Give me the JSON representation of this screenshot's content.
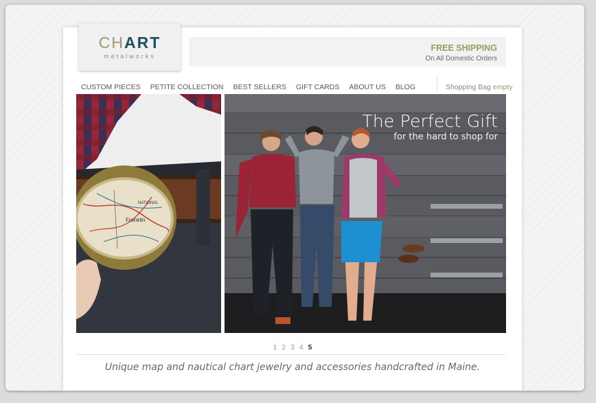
{
  "logo": {
    "part1": "CH",
    "part2": "ART",
    "sub": "metalworks"
  },
  "shipping": {
    "title": "FREE SHIPPING",
    "sub": "On All Domestic Orders"
  },
  "nav": {
    "items": [
      "CUSTOM PIECES",
      "PETITE COLLECTION",
      "BEST SELLERS",
      "GIFT CARDS",
      "ABOUT US",
      "BLOG"
    ]
  },
  "bag": {
    "label": "Shopping Bag",
    "status": "empty"
  },
  "slider": {
    "title": "The Perfect Gift",
    "subtitle": "for the hard to shop for",
    "pages": [
      "1",
      "2",
      "3",
      "4",
      "5"
    ],
    "active_page": "5"
  },
  "belt_map_labels": {
    "city": "Franklin",
    "label2": "NATIONAL"
  },
  "tagline": "Unique map and nautical chart jewelry and accessories handcrafted in Maine.",
  "colors": {
    "accent": "#9a9a60",
    "logo_art": "#1d4f5e"
  }
}
